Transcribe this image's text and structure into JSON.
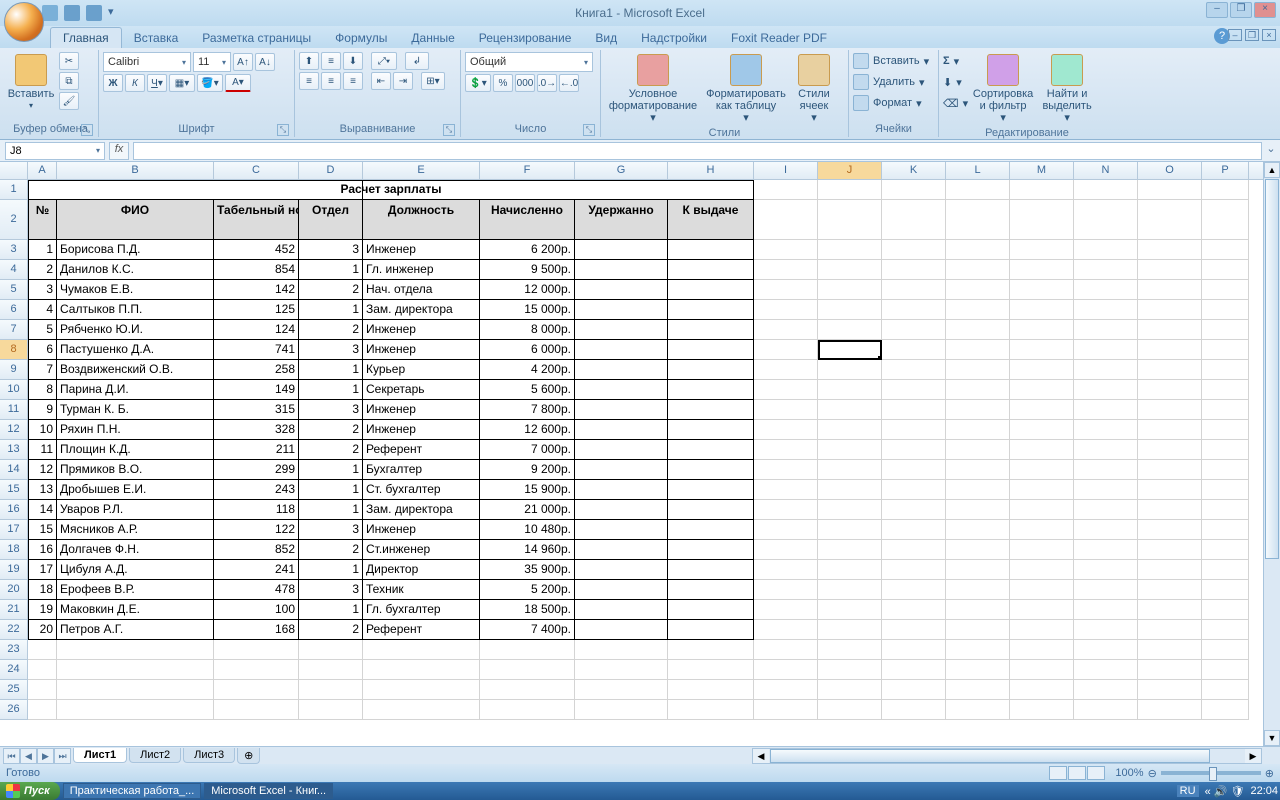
{
  "titlebar": {
    "title": "Книга1 - Microsoft Excel"
  },
  "tabs": [
    "Главная",
    "Вставка",
    "Разметка страницы",
    "Формулы",
    "Данные",
    "Рецензирование",
    "Вид",
    "Надстройки",
    "Foxit Reader PDF"
  ],
  "ribbon": {
    "clipboard": {
      "paste": "Вставить",
      "label": "Буфер обмена"
    },
    "font": {
      "name": "Calibri",
      "size": "11",
      "label": "Шрифт"
    },
    "align": {
      "label": "Выравнивание"
    },
    "number": {
      "format": "Общий",
      "label": "Число"
    },
    "styles": {
      "cond": "Условное форматирование",
      "table": "Форматировать как таблицу",
      "cell": "Стили ячеек",
      "label": "Стили"
    },
    "cells": {
      "insert": "Вставить",
      "delete": "Удалить",
      "format": "Формат",
      "label": "Ячейки"
    },
    "editing": {
      "sort": "Сортировка и фильтр",
      "find": "Найти и выделить",
      "label": "Редактирование"
    }
  },
  "namebox": "J8",
  "columns": [
    "A",
    "B",
    "C",
    "D",
    "E",
    "F",
    "G",
    "H",
    "I",
    "J",
    "K",
    "L",
    "M",
    "N",
    "O",
    "P"
  ],
  "table": {
    "title": "Расчет зарплаты",
    "headers": {
      "no": "№",
      "fio": "ФИО",
      "tab": "Табельный номер",
      "dept": "Отдел",
      "pos": "Должность",
      "accr": "Начисленно",
      "ded": "Удержанно",
      "pay": "К выдаче"
    },
    "rows": [
      {
        "n": "1",
        "fio": "Борисова П.Д.",
        "tab": "452",
        "d": "3",
        "pos": "Инженер",
        "acc": "6 200р."
      },
      {
        "n": "2",
        "fio": "Данилов К.С.",
        "tab": "854",
        "d": "1",
        "pos": "Гл. инженер",
        "acc": "9 500р."
      },
      {
        "n": "3",
        "fio": "Чумаков Е.В.",
        "tab": "142",
        "d": "2",
        "pos": "Нач. отдела",
        "acc": "12 000р."
      },
      {
        "n": "4",
        "fio": "Салтыков П.П.",
        "tab": "125",
        "d": "1",
        "pos": "Зам. директора",
        "acc": "15 000р."
      },
      {
        "n": "5",
        "fio": "Рябченко Ю.И.",
        "tab": "124",
        "d": "2",
        "pos": "Инженер",
        "acc": "8 000р."
      },
      {
        "n": "6",
        "fio": "Пастушенко Д.А.",
        "tab": "741",
        "d": "3",
        "pos": "Инженер",
        "acc": "6 000р."
      },
      {
        "n": "7",
        "fio": "Воздвиженский О.В.",
        "tab": "258",
        "d": "1",
        "pos": "Курьер",
        "acc": "4 200р."
      },
      {
        "n": "8",
        "fio": "Парина Д.И.",
        "tab": "149",
        "d": "1",
        "pos": "Секретарь",
        "acc": "5 600р."
      },
      {
        "n": "9",
        "fio": "Турман К. Б.",
        "tab": "315",
        "d": "3",
        "pos": "Инженер",
        "acc": "7 800р."
      },
      {
        "n": "10",
        "fio": "Ряхин П.Н.",
        "tab": "328",
        "d": "2",
        "pos": "Инженер",
        "acc": "12 600р."
      },
      {
        "n": "11",
        "fio": "Площин К.Д.",
        "tab": "211",
        "d": "2",
        "pos": "Референт",
        "acc": "7 000р."
      },
      {
        "n": "12",
        "fio": "Прямиков В.О.",
        "tab": "299",
        "d": "1",
        "pos": "Бухгалтер",
        "acc": "9 200р."
      },
      {
        "n": "13",
        "fio": "Дробышев Е.И.",
        "tab": "243",
        "d": "1",
        "pos": "Ст. бухгалтер",
        "acc": "15 900р."
      },
      {
        "n": "14",
        "fio": "Уваров Р.Л.",
        "tab": "118",
        "d": "1",
        "pos": "Зам. директора",
        "acc": "21 000р."
      },
      {
        "n": "15",
        "fio": "Мясников А.Р.",
        "tab": "122",
        "d": "3",
        "pos": "Инженер",
        "acc": "10 480р."
      },
      {
        "n": "16",
        "fio": "Долгачев Ф.Н.",
        "tab": "852",
        "d": "2",
        "pos": "Ст.инженер",
        "acc": "14 960р."
      },
      {
        "n": "17",
        "fio": "Цибуля А.Д.",
        "tab": "241",
        "d": "1",
        "pos": "Директор",
        "acc": "35 900р."
      },
      {
        "n": "18",
        "fio": "Ерофеев В.Р.",
        "tab": "478",
        "d": "3",
        "pos": "Техник",
        "acc": "5 200р."
      },
      {
        "n": "19",
        "fio": "Маковкин Д.Е.",
        "tab": "100",
        "d": "1",
        "pos": "Гл. бухгалтер",
        "acc": "18 500р."
      },
      {
        "n": "20",
        "fio": "Петров А.Г.",
        "tab": "168",
        "d": "2",
        "pos": "Референт",
        "acc": "7 400р."
      }
    ]
  },
  "sheets": [
    "Лист1",
    "Лист2",
    "Лист3"
  ],
  "status": {
    "ready": "Готово",
    "zoom": "100%"
  },
  "taskbar": {
    "start": "Пуск",
    "btn1": "Практическая работа_...",
    "btn2": "Microsoft Excel - Книг...",
    "lang": "RU",
    "time": "22:04"
  },
  "selected_cell": "J8"
}
